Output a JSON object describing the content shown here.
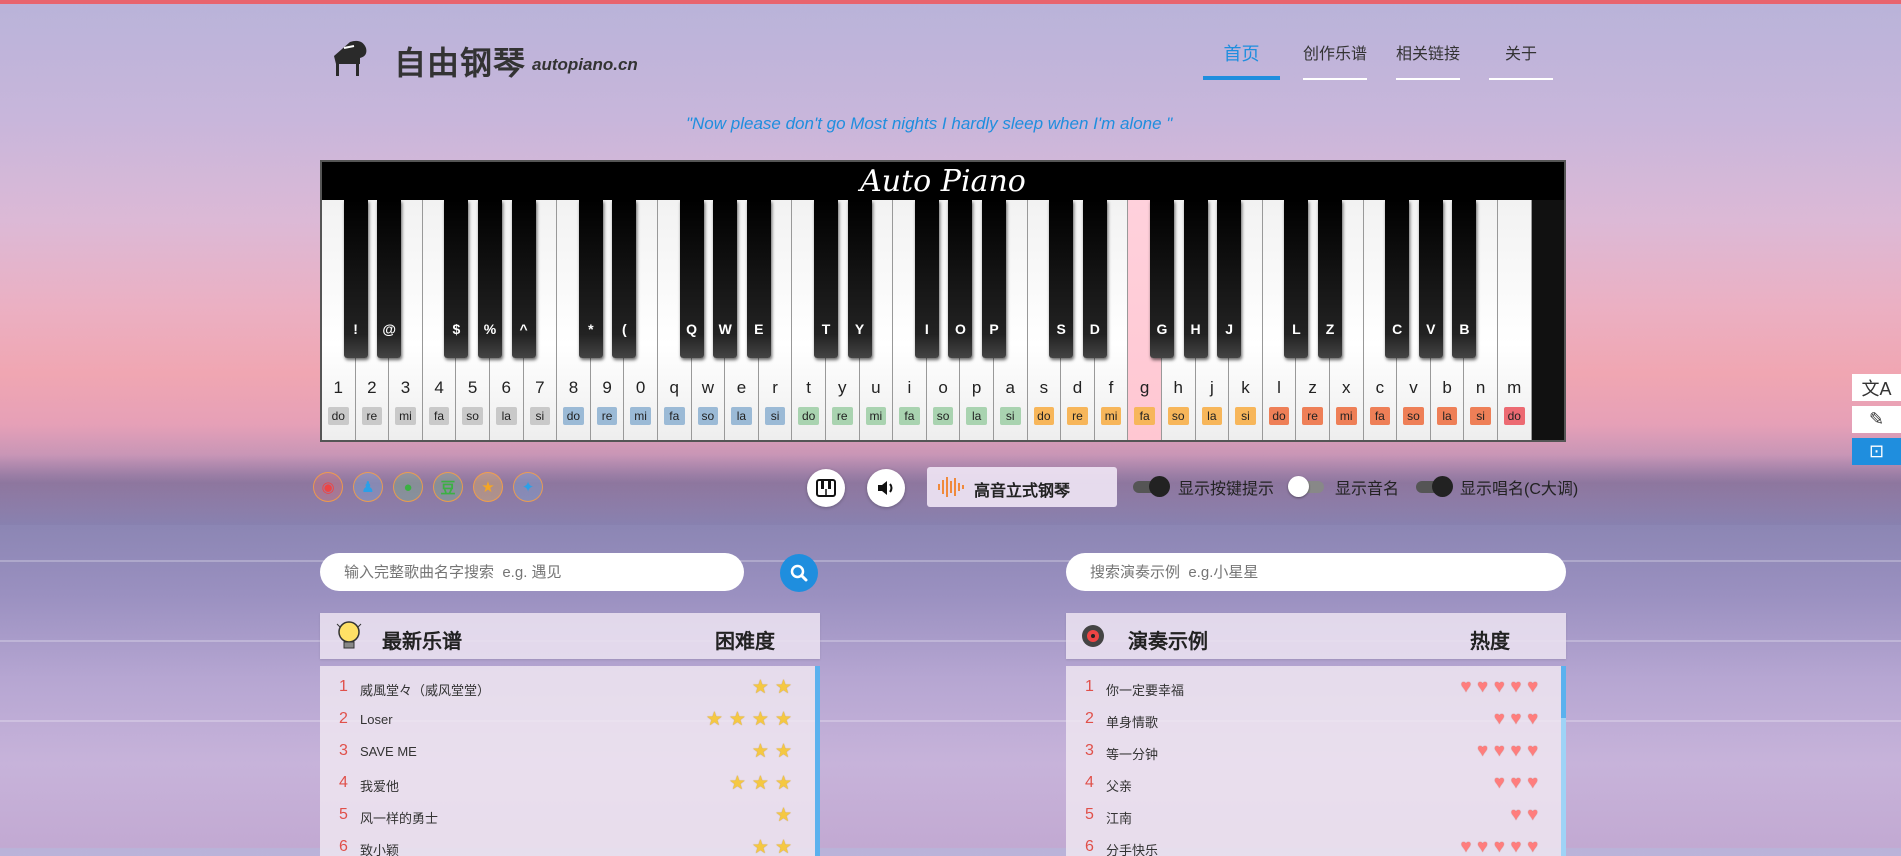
{
  "header": {
    "logo_text": "自由钢琴",
    "logo_sub": "autopiano.cn",
    "nav": [
      {
        "label": "首页",
        "active": true
      },
      {
        "label": "创作乐谱",
        "active": false
      },
      {
        "label": "相关链接",
        "active": false
      },
      {
        "label": "关于",
        "active": false
      }
    ]
  },
  "quote": "\"Now please don't go Most nights I hardly sleep when I'm alone \"",
  "piano": {
    "brand": "Auto Piano",
    "white_keys": [
      {
        "key": "1",
        "note": "do",
        "color": "#c9c9c9"
      },
      {
        "key": "2",
        "note": "re",
        "color": "#c9c9c9"
      },
      {
        "key": "3",
        "note": "mi",
        "color": "#c9c9c9"
      },
      {
        "key": "4",
        "note": "fa",
        "color": "#c9c9c9"
      },
      {
        "key": "5",
        "note": "so",
        "color": "#c9c9c9"
      },
      {
        "key": "6",
        "note": "la",
        "color": "#c9c9c9"
      },
      {
        "key": "7",
        "note": "si",
        "color": "#c9c9c9"
      },
      {
        "key": "8",
        "note": "do",
        "color": "#9bbad6"
      },
      {
        "key": "9",
        "note": "re",
        "color": "#9bbad6"
      },
      {
        "key": "0",
        "note": "mi",
        "color": "#9bbad6"
      },
      {
        "key": "q",
        "note": "fa",
        "color": "#9bbad6"
      },
      {
        "key": "w",
        "note": "so",
        "color": "#9bbad6"
      },
      {
        "key": "e",
        "note": "la",
        "color": "#9bbad6"
      },
      {
        "key": "r",
        "note": "si",
        "color": "#9bbad6"
      },
      {
        "key": "t",
        "note": "do",
        "color": "#a9d3b0"
      },
      {
        "key": "y",
        "note": "re",
        "color": "#a9d3b0"
      },
      {
        "key": "u",
        "note": "mi",
        "color": "#a9d3b0"
      },
      {
        "key": "i",
        "note": "fa",
        "color": "#a9d3b0"
      },
      {
        "key": "o",
        "note": "so",
        "color": "#a9d3b0"
      },
      {
        "key": "p",
        "note": "la",
        "color": "#a9d3b0"
      },
      {
        "key": "a",
        "note": "si",
        "color": "#a9d3b0"
      },
      {
        "key": "s",
        "note": "do",
        "color": "#f7b65a"
      },
      {
        "key": "d",
        "note": "re",
        "color": "#f7b65a"
      },
      {
        "key": "f",
        "note": "mi",
        "color": "#f7b65a"
      },
      {
        "key": "g",
        "note": "fa",
        "color": "#f7b65a",
        "highlight": true
      },
      {
        "key": "h",
        "note": "so",
        "color": "#f7b65a"
      },
      {
        "key": "j",
        "note": "la",
        "color": "#f7b65a"
      },
      {
        "key": "k",
        "note": "si",
        "color": "#f7b65a"
      },
      {
        "key": "l",
        "note": "do",
        "color": "#ee7f57"
      },
      {
        "key": "z",
        "note": "re",
        "color": "#ee7f57"
      },
      {
        "key": "x",
        "note": "mi",
        "color": "#ee7f57"
      },
      {
        "key": "c",
        "note": "fa",
        "color": "#ee7f57"
      },
      {
        "key": "v",
        "note": "so",
        "color": "#ee7f57"
      },
      {
        "key": "b",
        "note": "la",
        "color": "#ee7f57"
      },
      {
        "key": "n",
        "note": "si",
        "color": "#ee7f57"
      },
      {
        "key": "m",
        "note": "do",
        "color": "#ec6a72"
      }
    ],
    "black_keys": [
      "!",
      "@",
      "",
      "$",
      "%",
      "^",
      "",
      "*",
      "(",
      "",
      "Q",
      "W",
      "E",
      "",
      "T",
      "Y",
      "",
      "I",
      "O",
      "P",
      "",
      "S",
      "D",
      "",
      "G",
      "H",
      "J",
      "",
      "L",
      "Z",
      "",
      "C",
      "V",
      "B",
      ""
    ]
  },
  "controls": {
    "share_icons": [
      "weibo-icon",
      "qq-icon",
      "wechat-icon",
      "douban-icon",
      "qzone-icon",
      "twitter-icon"
    ],
    "instrument_label": "高音立式钢琴",
    "toggles": [
      {
        "label": "显示按键提示",
        "on": true
      },
      {
        "label": "显示音名",
        "on": false
      },
      {
        "label": "显示唱名(C大调)",
        "on": true
      }
    ]
  },
  "search": {
    "left_placeholder": "输入完整歌曲名字搜索  e.g. 遇见",
    "right_placeholder": "搜索演奏示例  e.g.小星星"
  },
  "left_panel": {
    "title": "最新乐谱",
    "col": "困难度",
    "rows": [
      {
        "num": "1",
        "name": "威風堂々（威风堂堂）",
        "rating": 2
      },
      {
        "num": "2",
        "name": "Loser",
        "rating": 4
      },
      {
        "num": "3",
        "name": "SAVE ME",
        "rating": 2
      },
      {
        "num": "4",
        "name": "我爱他",
        "rating": 3
      },
      {
        "num": "5",
        "name": "风一样的勇士",
        "rating": 1
      },
      {
        "num": "6",
        "name": "致小颖",
        "rating": 2
      }
    ]
  },
  "right_panel": {
    "title": "演奏示例",
    "col": "热度",
    "rows": [
      {
        "num": "1",
        "name": "你一定要幸福",
        "rating": 5
      },
      {
        "num": "2",
        "name": "单身情歌",
        "rating": 3
      },
      {
        "num": "3",
        "name": "等一分钟",
        "rating": 4
      },
      {
        "num": "4",
        "name": "父亲",
        "rating": 3
      },
      {
        "num": "5",
        "name": "江南",
        "rating": 2
      },
      {
        "num": "6",
        "name": "分手快乐",
        "rating": 5
      }
    ]
  }
}
